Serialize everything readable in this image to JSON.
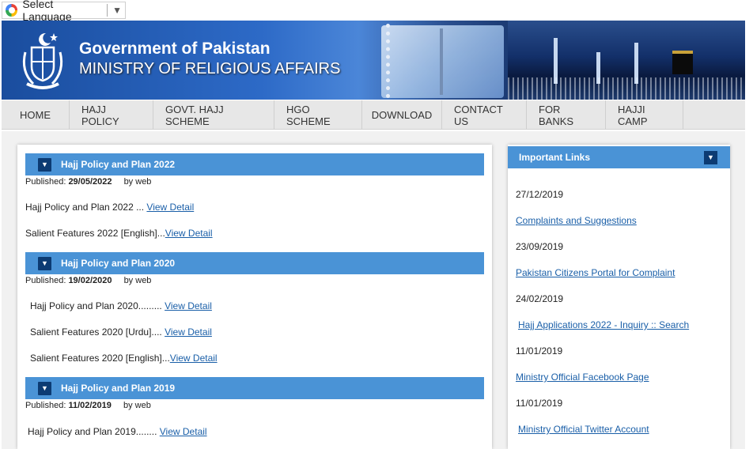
{
  "language": {
    "label": "Select Language",
    "arrow": "▼"
  },
  "header": {
    "line1": "Government of Pakistan",
    "line2": "MINISTRY OF RELIGIOUS AFFAIRS"
  },
  "nav": [
    "HOME",
    "HAJJ POLICY",
    "GOVT. HAJJ SCHEME",
    "HGO SCHEME",
    "DOWNLOAD",
    "CONTACT US",
    "FOR BANKS",
    "HAJJI CAMP"
  ],
  "colors": {
    "header_blue": "#4a93d6",
    "toggle_navy": "#0c3b73",
    "link": "#1a5fa8"
  },
  "sections": [
    {
      "title": "Hajj Policy and Plan 2022",
      "published_label": "Published:",
      "date": "29/05/2022",
      "by": "by",
      "author": "web",
      "items": [
        {
          "text": "Hajj Policy and Plan 2022  ... ",
          "link": "View Detail"
        },
        {
          "text": "Salient Features 2022 [English]...",
          "link": "View Detail"
        }
      ]
    },
    {
      "title": "Hajj Policy and Plan 2020",
      "published_label": "Published:",
      "date": "19/02/2020",
      "by": "by",
      "author": "web",
      "items": [
        {
          "text": "Hajj Policy and Plan 2020......... ",
          "link": "View Detail"
        },
        {
          "text": "Salient Features 2020 [Urdu].... ",
          "link": "View Detail"
        },
        {
          "text": "Salient Features 2020 [English]...",
          "link": "View Detail"
        }
      ]
    },
    {
      "title": "Hajj Policy and Plan 2019",
      "published_label": "Published:",
      "date": "11/02/2019",
      "by": "by",
      "author": "web",
      "items": [
        {
          "text": "Hajj Policy and Plan 2019........ ",
          "link": "View Detail"
        }
      ]
    }
  ],
  "sidebar": {
    "title": "Important Links",
    "entries": [
      {
        "date": "27/12/2019",
        "link": "Complaints and Suggestions"
      },
      {
        "date": "23/09/2019",
        "link": "Pakistan Citizens Portal for Complaint"
      },
      {
        "date": "24/02/2019",
        "link": "Hajj Applications 2022 - Inquiry :: Search"
      },
      {
        "date": "11/01/2019",
        "link": "Ministry Official Facebook Page"
      },
      {
        "date": "11/01/2019",
        "link": "Ministry Official Twitter Account"
      }
    ]
  }
}
